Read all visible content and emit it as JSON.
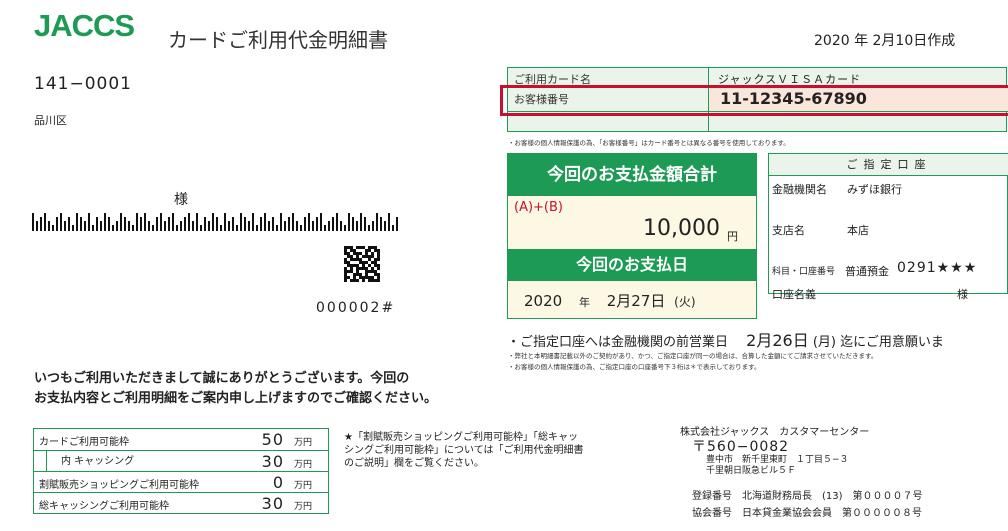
{
  "header": {
    "logo_text": "JACCS",
    "title": "カードご利用代金明細書",
    "issue_date": "2020 年 2月10日作成",
    "brand_color": "#1d9a54"
  },
  "address": {
    "postal_code": "141−0001",
    "ward": "品川区",
    "honorific": "様",
    "sequence_no": "000002#"
  },
  "greeting": {
    "line1": "いつもご利用いただきまして誠にありがとうございます。今回の",
    "line2": "お支払内容とご利用明細をご案内申し上げますのでご確認ください。"
  },
  "credit_limits": {
    "unit": "万円",
    "rows": [
      {
        "label": "カードご利用可能枠",
        "value": "50"
      },
      {
        "label": "内 キャッシング",
        "value": "30"
      },
      {
        "label": "割賦販売ショッピングご利用可能枠",
        "value": "0"
      },
      {
        "label": "総キャッシングご利用可能枠",
        "value": "30"
      }
    ],
    "note": "★「割賦販売ショッピングご利用可能枠」「総キャッシングご利用可能枠」については「ご利用代金明細書のご説明」欄をご覧ください。"
  },
  "card_info": {
    "card_name_label": "ご利用カード名",
    "card_name": "ジャックスＶＩＳＡカード",
    "customer_no_label": "お客様番号",
    "customer_no": "11-12345-67890",
    "privacy_note": "・お客様の個人情報保護の為、「お客様番号」はカード番号とは異なる番号を使用しております。"
  },
  "payment": {
    "total_heading": "今回のお支払金額合計",
    "formula": "(A)+(B)",
    "amount": "10,000",
    "amount_unit": "円",
    "due_heading": "今回のお支払日",
    "due_year": "2020",
    "due_year_unit": "年",
    "due_date": "2月27日",
    "due_weekday": "(火)"
  },
  "account": {
    "heading": "ご指定口座",
    "bank_label": "金融機関名",
    "bank_value": "みずほ銀行",
    "branch_label": "支店名",
    "branch_value": "本店",
    "acct_no_label": "科目・口座番号",
    "acct_type": "普通預金",
    "acct_no": "0291★★★",
    "holder_label": "口座名義",
    "holder_honorific": "様"
  },
  "notice": {
    "prefix": "・ご指定口座へは金融機関の前営業日",
    "date": "2月26日",
    "weekday": "(月)",
    "suffix": "迄にご用意願いま",
    "small1": "・弊社と本明細書記載以外のご契約があり、かつ、ご指定口座が同一の場合は、合算した金額にてご請求させていただきます。",
    "small2": "・お客様の個人情報保護の為、ご指定口座の口座番号下３桁は＊で表示しております。"
  },
  "company": {
    "name": "株式会社ジャックス　カスタマーセンター",
    "zip": "〒560−0082",
    "address1": "豊中市　新千里東町　１丁目５−３",
    "address2": "千里朝日阪急ビル５Ｆ",
    "reg1": "登録番号　北海道財務局長　(13)　第００００７号",
    "reg2": "協会番号　日本貸金業協会会員　第０００００８号"
  }
}
